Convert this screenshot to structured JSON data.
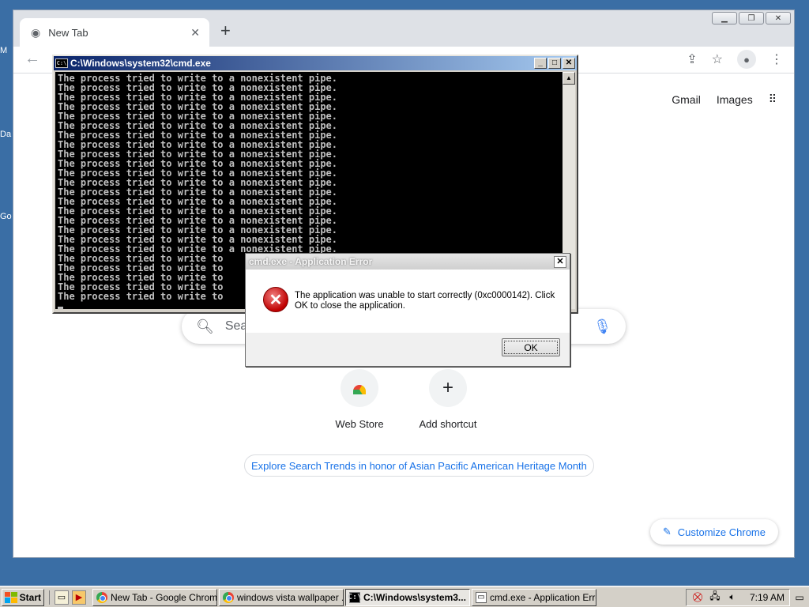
{
  "desktop": {
    "labels": [
      "M",
      "Da",
      "Go"
    ]
  },
  "chrome": {
    "tab_title": "New Tab",
    "tab_close": "✕",
    "new_tab": "+",
    "links": {
      "gmail": "Gmail",
      "images": "Images"
    },
    "search_placeholder": "Sear",
    "shortcuts": [
      {
        "label": "Web Store"
      },
      {
        "label": "Add shortcut"
      }
    ],
    "doodle_text": "Explore Search Trends in honor of Asian Pacific American Heritage Month",
    "customize_label": "Customize Chrome"
  },
  "cmd": {
    "title": "C:\\Windows\\system32\\cmd.exe",
    "line_text": "The process tried to write to a nonexistent pipe.",
    "line_count": 24,
    "partial_line": "The process tried to write to"
  },
  "dialog": {
    "title": "cmd.exe - Application Error",
    "message": "The application was unable to start correctly (0xc0000142). Click OK to close the application.",
    "ok_label": "OK",
    "close_glyph": "✕"
  },
  "taskbar": {
    "start_label": "Start",
    "tasks": [
      {
        "label": "New Tab - Google Chrome",
        "icon": "chrome-icon",
        "active": false
      },
      {
        "label": "windows vista wallpaper ...",
        "icon": "chrome-icon",
        "active": false
      },
      {
        "label": "C:\\Windows\\system3...",
        "icon": "cmd-icon",
        "active": true
      },
      {
        "label": "cmd.exe - Application Error",
        "icon": "dialog-icon",
        "active": false
      }
    ],
    "clock": "7:19 AM"
  },
  "colors": {
    "desktop": "#3a6ea5",
    "cmd_titlebar": "#0a246a",
    "error_red": "#c00000",
    "link_blue": "#1a73e8"
  }
}
